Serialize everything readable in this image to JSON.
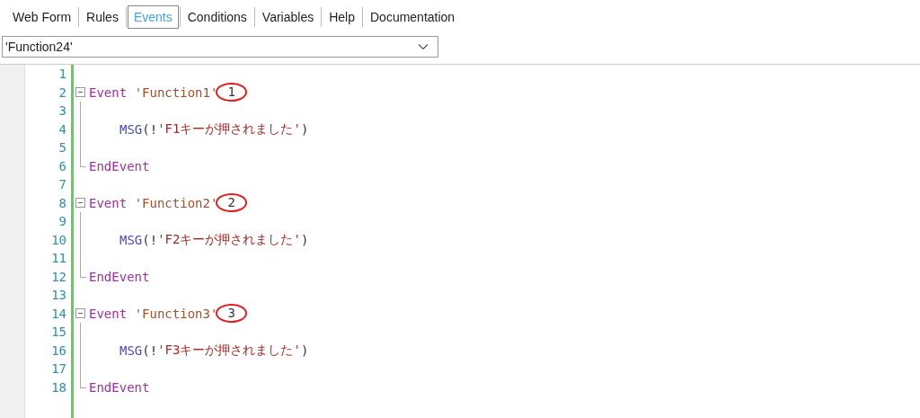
{
  "tabs": [
    {
      "label": "Web Form",
      "selected": false
    },
    {
      "label": "Rules",
      "selected": false
    },
    {
      "label": "Events",
      "selected": true
    },
    {
      "label": "Conditions",
      "selected": false
    },
    {
      "label": "Variables",
      "selected": false
    },
    {
      "label": "Help",
      "selected": false
    },
    {
      "label": "Documentation",
      "selected": false
    }
  ],
  "event_dropdown": {
    "value": "'Function24'"
  },
  "editor": {
    "lines": [
      {
        "number": "1",
        "kind": "blank"
      },
      {
        "number": "2",
        "kind": "event",
        "keyword": "Event",
        "name": "'Function1'",
        "callout": "1"
      },
      {
        "number": "3",
        "kind": "blank"
      },
      {
        "number": "4",
        "kind": "call",
        "func": "MSG",
        "open": "(!",
        "arg": "'F1キーが押されました'",
        "close": ")"
      },
      {
        "number": "5",
        "kind": "blank"
      },
      {
        "number": "6",
        "kind": "end",
        "keyword": "EndEvent"
      },
      {
        "number": "7",
        "kind": "blank"
      },
      {
        "number": "8",
        "kind": "event",
        "keyword": "Event",
        "name": "'Function2'",
        "callout": "2"
      },
      {
        "number": "9",
        "kind": "blank"
      },
      {
        "number": "10",
        "kind": "call",
        "func": "MSG",
        "open": "(!",
        "arg": "'F2キーが押されました'",
        "close": ")"
      },
      {
        "number": "11",
        "kind": "blank"
      },
      {
        "number": "12",
        "kind": "end",
        "keyword": "EndEvent"
      },
      {
        "number": "13",
        "kind": "blank"
      },
      {
        "number": "14",
        "kind": "event",
        "keyword": "Event",
        "name": "'Function3'",
        "callout": "3"
      },
      {
        "number": "15",
        "kind": "blank"
      },
      {
        "number": "16",
        "kind": "call",
        "func": "MSG",
        "open": "(!",
        "arg": "'F3キーが押されました'",
        "close": ")"
      },
      {
        "number": "17",
        "kind": "blank"
      },
      {
        "number": "18",
        "kind": "end",
        "keyword": "EndEvent"
      }
    ]
  }
}
